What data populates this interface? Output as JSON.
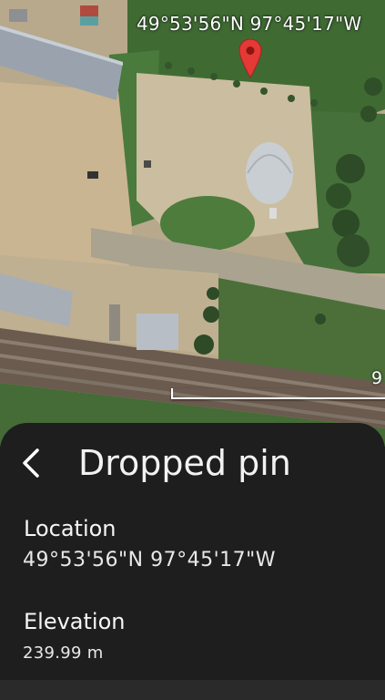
{
  "map": {
    "coordinates_overlay": "49°53'56\"N 97°45'17\"W",
    "scale_label": "9"
  },
  "sheet": {
    "title": "Dropped pin",
    "location_label": "Location",
    "location_value": "49°53'56\"N 97°45'17\"W",
    "elevation_label": "Elevation",
    "elevation_value": "239.99 m"
  },
  "colors": {
    "pin": "#e53935",
    "sheet_background": "#1e1e1e"
  }
}
